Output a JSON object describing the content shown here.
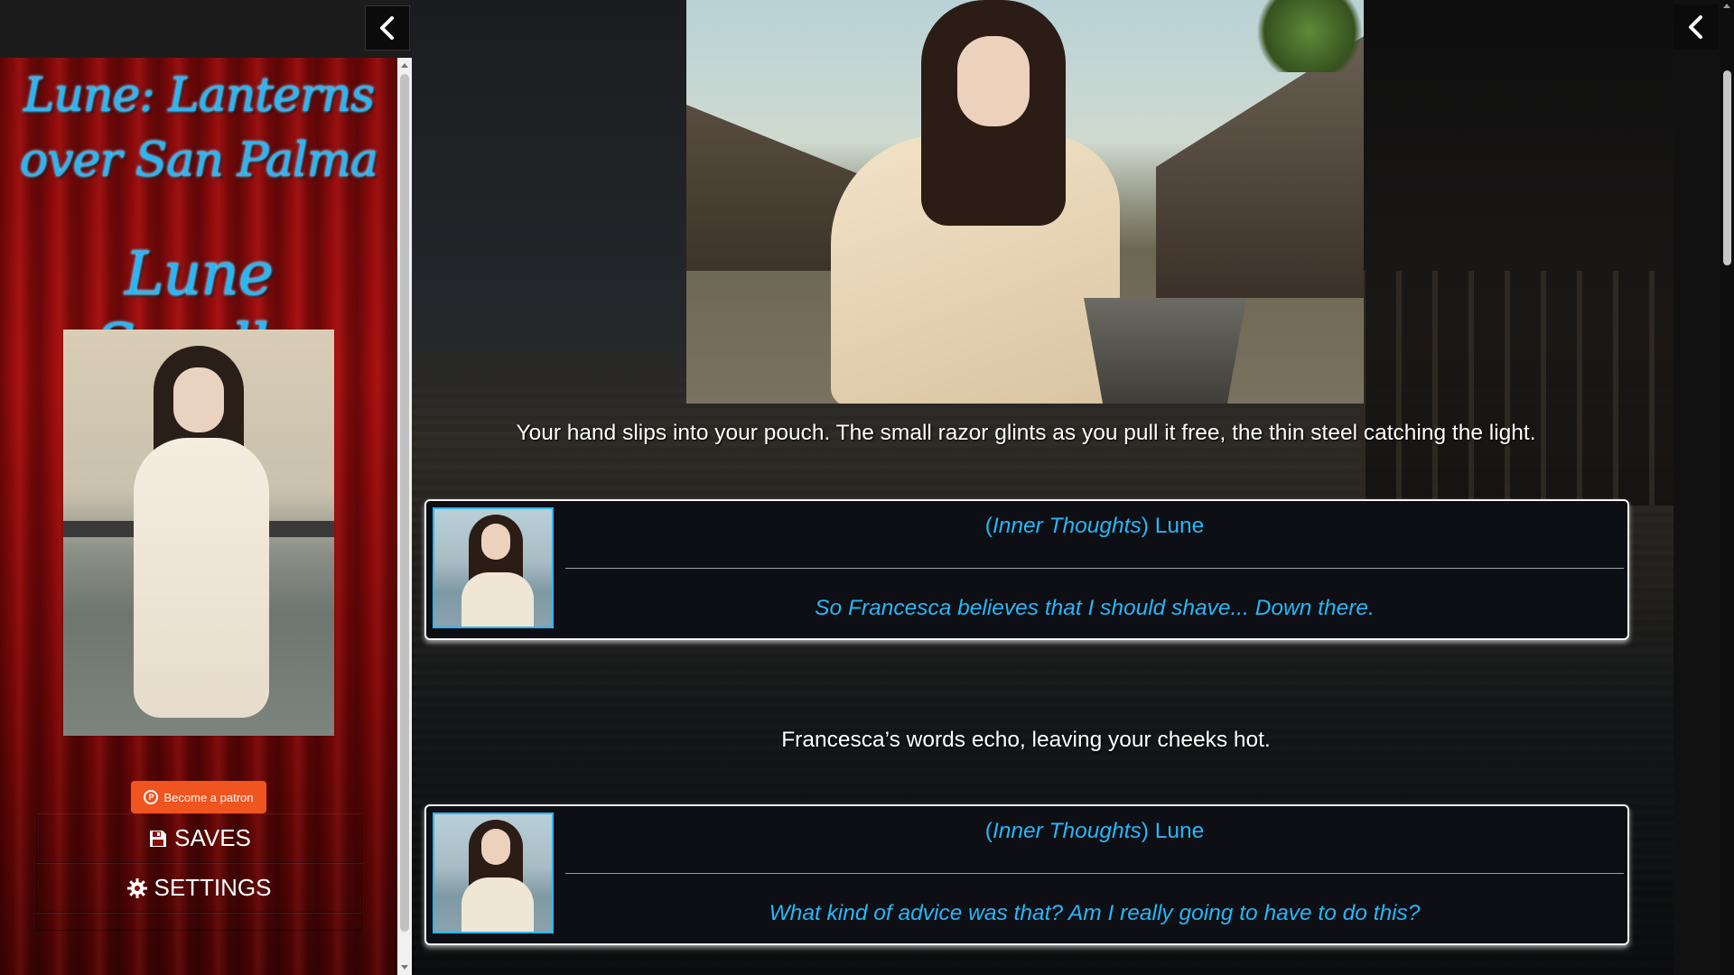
{
  "sidebar": {
    "toggle_icon": "chevron-left-icon",
    "story_title": "Lune: Lanterns over San Palma",
    "character_name": "Lune Sorelle",
    "patron_button": "Become a patron",
    "menu": [
      {
        "label": "SAVES",
        "icon": "floppy-disk-icon"
      },
      {
        "label": "SETTINGS",
        "icon": "gear-icon"
      }
    ],
    "accent_color": "#29b6f6",
    "curtain_color": "#8b0a0a"
  },
  "passage": {
    "narration": [
      "Your hand slips into your pouch. The small razor glints as you pull it free, the thin steel catching the light.",
      "Francesca’s words echo, leaving your cheeks hot."
    ],
    "dialogs": [
      {
        "speaker_tag": "Inner Thoughts",
        "speaker_name": "Lune",
        "line": "So Francesca believes that I should shave... Down there."
      },
      {
        "speaker_tag": "Inner Thoughts",
        "speaker_name": "Lune",
        "line": "What kind of advice was that? Am I really going to have to do this?"
      }
    ]
  },
  "right_panel": {
    "toggle_icon": "chevron-left-icon"
  }
}
